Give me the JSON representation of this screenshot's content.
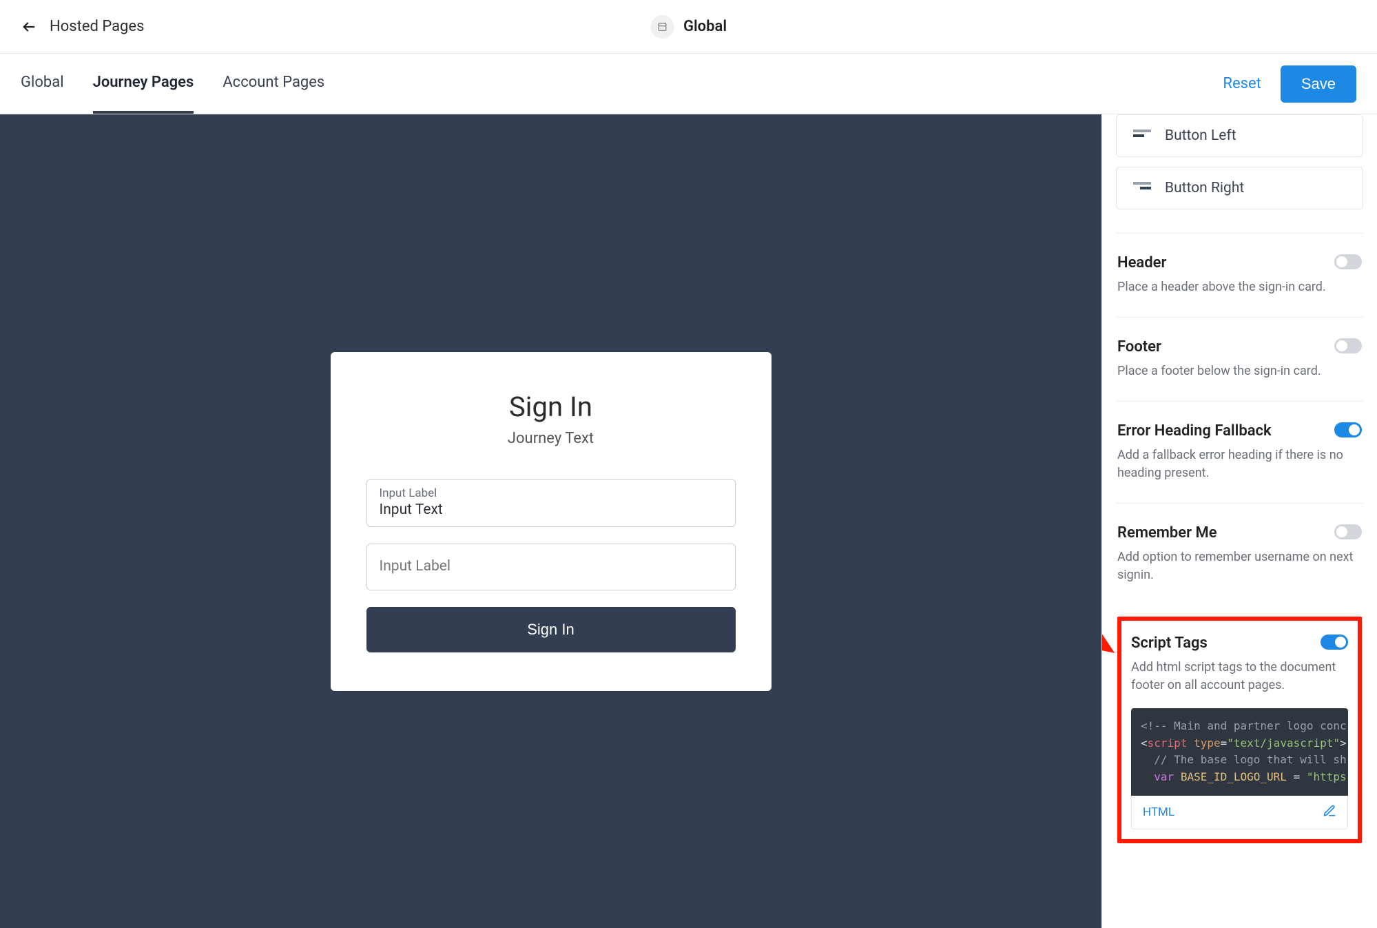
{
  "topbar": {
    "title": "Hosted Pages",
    "scope_label": "Global"
  },
  "tabs": {
    "items": [
      "Global",
      "Journey Pages",
      "Account Pages"
    ],
    "active_index": 1,
    "reset_label": "Reset",
    "save_label": "Save"
  },
  "preview": {
    "heading": "Sign In",
    "subheading": "Journey Text",
    "field1_label": "Input Label",
    "field1_value": "Input Text",
    "field2_label": "Input Label",
    "button_label": "Sign In"
  },
  "panel": {
    "button_left_label": "Button Left",
    "button_right_label": "Button Right",
    "sections": {
      "header": {
        "title": "Header",
        "desc": "Place a header above the sign-in card.",
        "on": false
      },
      "footer": {
        "title": "Footer",
        "desc": "Place a footer below the sign-in card.",
        "on": false
      },
      "error": {
        "title": "Error Heading Fallback",
        "desc": "Add a fallback error heading if there is no heading present.",
        "on": true
      },
      "remember": {
        "title": "Remember Me",
        "desc": "Add option to remember username on next signin.",
        "on": false
      },
      "script": {
        "title": "Script Tags",
        "desc": "Add html script tags to the document footer on all account pages.",
        "on": true,
        "lang_label": "HTML",
        "code": {
          "l1_a": "<!-- Main and partner logo conc",
          "l2_tag_open": "<",
          "l2_tag_name": "script",
          "l2_attr_name": "type",
          "l2_attr_eq": "=",
          "l2_attr_val": "\"text/javascript\"",
          "l2_tag_close": ">",
          "l3": "// The base logo that will sh",
          "l4_kw": "var",
          "l4_var": "BASE_ID_LOGO_URL",
          "l4_eq": " = ",
          "l4_str": "\"https"
        }
      }
    }
  }
}
